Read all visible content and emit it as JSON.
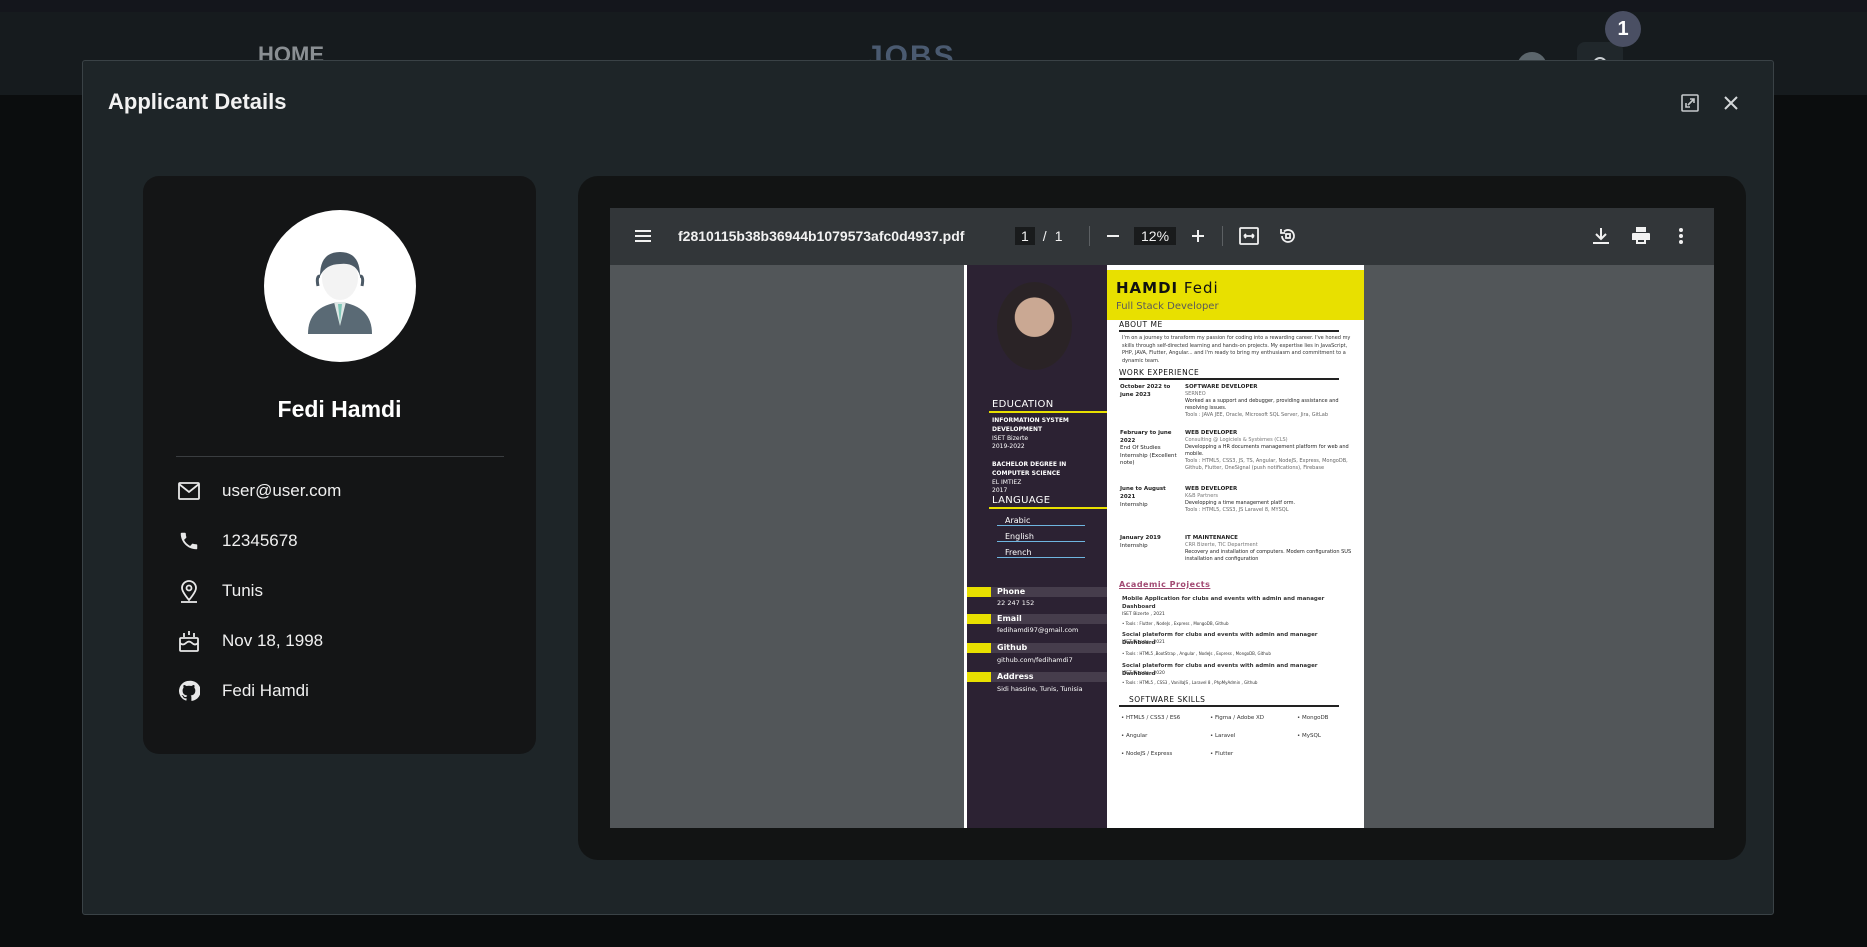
{
  "nav": {
    "home": "HOME",
    "logo": "JOBS",
    "badge": "1"
  },
  "modal": {
    "title": "Applicant Details"
  },
  "profile": {
    "name": "Fedi Hamdi",
    "email": "user@user.com",
    "phone": "12345678",
    "location": "Tunis",
    "birthdate": "Nov 18, 1998",
    "github": "Fedi Hamdi"
  },
  "pdf": {
    "filename": "f2810115b38b36944b1079573afc0d4937.pdf",
    "page_current": "1",
    "page_sep": "/",
    "page_total": "1",
    "zoom": "12%"
  },
  "cv": {
    "last_name": "HAMDI",
    "first_name": "Fedi",
    "role": "Full Stack Developer",
    "about_title": "ABOUT ME",
    "about_text": "I'm on a journey to transform my passion for coding into a rewarding career. I've honed my skills through self-directed learning and hands-on projects. My expertise lies in JavaScript, PHP, JAVA, Flutter, Angular... and I'm ready to bring my enthusiasm and commitment to a dynamic team.",
    "work_title": "WORK EXPERIENCE",
    "jobs": [
      {
        "date": "October 2022 to june 2023",
        "title": "SOFTWARE DEVELOPER",
        "company": "SERNEO",
        "desc": "Worked as a support and debugger, providing assistance and resolving issues.",
        "tools": "Tools : JAVA JEE, Oracle, Microsoft SQL Server, Jira, GitLab"
      },
      {
        "date": "February to june 2022",
        "sub": "End Of Studies Internship (Excellent note)",
        "title": "WEB DEVELOPER",
        "company": "Consulting @ Logiciels & Systèmes (CLS)",
        "desc": "Developping a HR documents management platform for web and mobile.",
        "tools": "Tools : HTML5, CSS3, JS, TS, Angular, NodeJS, Express, MongoDB, Github, Flutter, OneSignal (push notifications), Firebase"
      },
      {
        "date": "June to August 2021",
        "sub": "Internship",
        "title": "WEB DEVELOPER",
        "company": "K&B Partners",
        "desc": "Developping a time management platf orm.",
        "tools": "Tools : HTML5, CSS3, JS Laravel 8, MYSQL"
      },
      {
        "date": "January 2019",
        "sub": "Internship",
        "title": "IT MAINTENANCE",
        "company": "CRR Bizerte, TIC Department",
        "desc": "Recovery and installation of computers. Modem configuration SUS installation and configuration",
        "tools": ""
      }
    ],
    "projects_title": "Academic Projects",
    "projects": [
      {
        "title": "Mobile Application for clubs and events with admin and manager Dashboard",
        "place": "ISET Bizerte , 2021",
        "tools": "• Tools : Flutter , NodeJs , Express , MongoDB, Github"
      },
      {
        "title": "Social plateform for clubs and events with admin and manager Dashboard",
        "place": "ISET Bizerte , 2021",
        "tools": "• Tools : HTML5 ,BootStrap , Angular , NodeJs , Express , MongoDB, Github"
      },
      {
        "title": "Social plateform for clubs and events with admin and manager Dashboard",
        "place": "ISET Bizerte , 2020",
        "tools": "• Tools : HTML5 , CSS3 , VanillaJS , Laravel 8 , PhpMyAdmin , Github"
      }
    ],
    "skills_title": "SOFTWARE SKILLS",
    "skills": [
      "• HTML5 / CSS3 / ES6",
      "• Figma / Adobe XD",
      "• MongoDB",
      "• Angular",
      "• Laravel",
      "• MySQL",
      "• NodeJS / Express",
      "• Flutter"
    ],
    "education_title": "EDUCATION",
    "education": [
      {
        "degree": "INFORMATION SYSTEM DEVELOPMENT",
        "school": "ISET Bizerte",
        "years": "2019-2022"
      },
      {
        "degree": "BACHELOR DEGREE IN COMPUTER SCIENCE",
        "school": "EL IMTIEZ",
        "years": "2017"
      }
    ],
    "language_title": "LANGUAGE",
    "languages": [
      "Arabic",
      "English",
      "French"
    ],
    "contacts": [
      {
        "label": "Phone",
        "value": "22 247 152"
      },
      {
        "label": "Email",
        "value": "fedihamdi97@gmail.com"
      },
      {
        "label": "Github",
        "value": "github.com/fedihamdi7"
      },
      {
        "label": "Address",
        "value": "Sidi hassine, Tunis, Tunisia"
      }
    ]
  }
}
